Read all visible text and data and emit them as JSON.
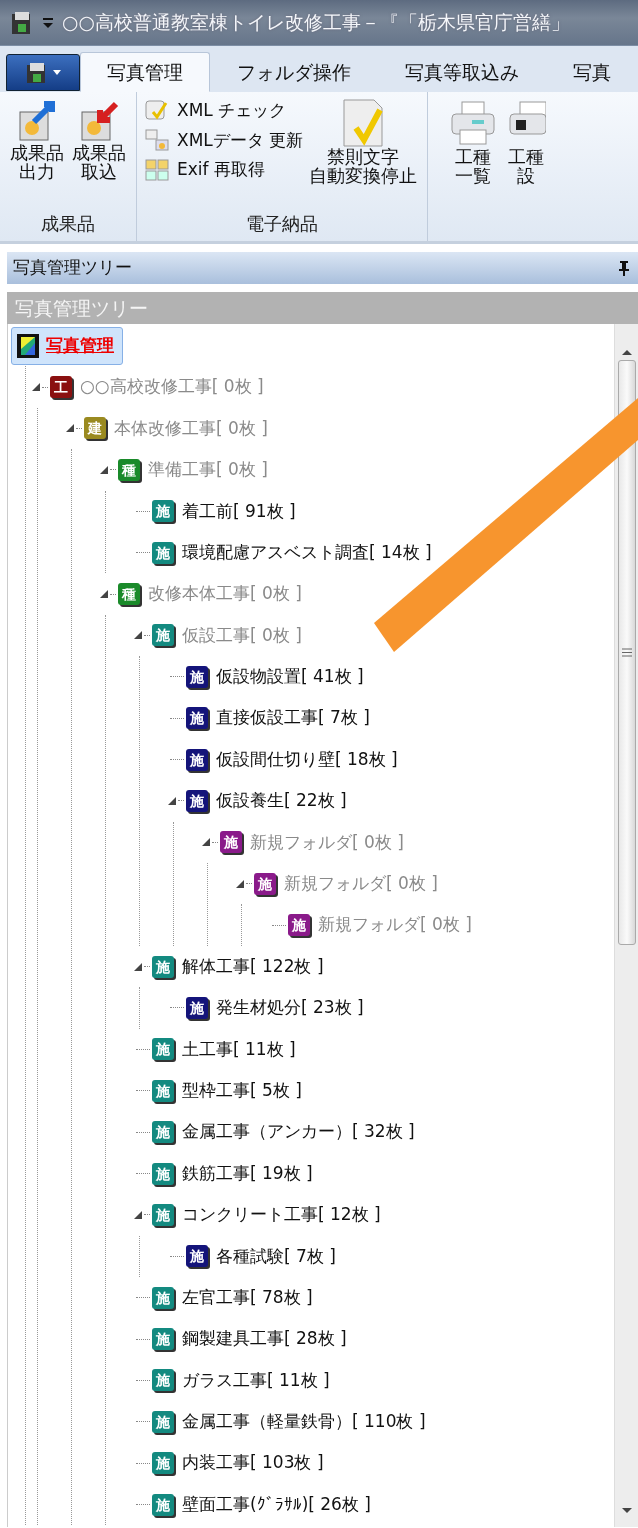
{
  "window": {
    "title": "○○高校普通教室棟トイレ改修工事－『「栃木県官庁営繕」"
  },
  "ribbon": {
    "tabs": [
      {
        "label": "写真管理",
        "selected": true
      },
      {
        "label": "フォルダ操作",
        "selected": false
      },
      {
        "label": "写真等取込み",
        "selected": false
      },
      {
        "label": "写真",
        "selected": false
      }
    ],
    "groups": [
      {
        "label": "成果品",
        "items": [
          {
            "kind": "large",
            "lines": [
              "成果品",
              "出力"
            ]
          },
          {
            "kind": "large",
            "lines": [
              "成果品",
              "取込"
            ]
          }
        ]
      },
      {
        "label": "電子納品",
        "items": [
          {
            "kind": "small",
            "lines": [
              "XML チェック"
            ]
          },
          {
            "kind": "small",
            "lines": [
              "XMLデータ 更新"
            ]
          },
          {
            "kind": "small",
            "lines": [
              "Exif 再取得"
            ]
          },
          {
            "kind": "large",
            "lines": [
              "禁則文字",
              "自動変換停止"
            ]
          }
        ]
      },
      {
        "items": [
          {
            "kind": "large",
            "lines": [
              "工種",
              "一覧"
            ]
          },
          {
            "kind": "large",
            "lines": [
              "工種",
              "設"
            ]
          }
        ]
      }
    ]
  },
  "panel": {
    "title": "写真管理ツリー",
    "subtitle": "写真管理ツリー"
  },
  "tree": {
    "label": "写真管理",
    "selected": true,
    "children": [
      {
        "mark": "工",
        "color": "#8a1010",
        "label": "○○高校改修工事[ 0枚 ]",
        "dimmed": true,
        "expanded": true,
        "children": [
          {
            "mark": "建",
            "color": "#9a8a20",
            "label": "本体改修工事[ 0枚 ]",
            "dimmed": true,
            "expanded": true,
            "children": [
              {
                "mark": "種",
                "color": "#1a8a2a",
                "label": "準備工事[ 0枚 ]",
                "dimmed": true,
                "expanded": true,
                "children": [
                  {
                    "mark": "施",
                    "color": "#138a80",
                    "label": "着工前[ 91枚 ]",
                    "dimmed": false
                  },
                  {
                    "mark": "施",
                    "color": "#138a80",
                    "label": "環境配慮アスベスト調査[ 14枚 ]",
                    "dimmed": false
                  }
                ]
              },
              {
                "mark": "種",
                "color": "#1a8a2a",
                "label": "改修本体工事[ 0枚 ]",
                "dimmed": true,
                "expanded": true,
                "children": [
                  {
                    "mark": "施",
                    "color": "#138a80",
                    "label": "仮設工事[ 0枚 ]",
                    "dimmed": true,
                    "expanded": true,
                    "children": [
                      {
                        "mark": "施",
                        "color": "#14147a",
                        "label": "仮設物設置[ 41枚 ]",
                        "dimmed": false
                      },
                      {
                        "mark": "施",
                        "color": "#14147a",
                        "label": "直接仮設工事[ 7枚 ]",
                        "dimmed": false
                      },
                      {
                        "mark": "施",
                        "color": "#14147a",
                        "label": "仮設間仕切り壁[ 18枚 ]",
                        "dimmed": false
                      },
                      {
                        "mark": "施",
                        "color": "#14147a",
                        "label": "仮設養生[ 22枚 ]",
                        "dimmed": false,
                        "expanded": true,
                        "children": [
                          {
                            "mark": "施",
                            "color": "#8a1a8a",
                            "label": "新規フォルダ[ 0枚 ]",
                            "dimmed": true,
                            "expanded": true,
                            "children": [
                              {
                                "mark": "施",
                                "color": "#8a1a8a",
                                "label": "新規フォルダ[ 0枚 ]",
                                "dimmed": true,
                                "expanded": true,
                                "children": [
                                  {
                                    "mark": "施",
                                    "color": "#8a1a8a",
                                    "label": "新規フォルダ[ 0枚 ]",
                                    "dimmed": true
                                  }
                                ]
                              }
                            ]
                          }
                        ]
                      }
                    ]
                  },
                  {
                    "mark": "施",
                    "color": "#138a80",
                    "label": "解体工事[ 122枚 ]",
                    "dimmed": false,
                    "expanded": true,
                    "children": [
                      {
                        "mark": "施",
                        "color": "#14147a",
                        "label": "発生材処分[ 23枚 ]",
                        "dimmed": false
                      }
                    ]
                  },
                  {
                    "mark": "施",
                    "color": "#138a80",
                    "label": "土工事[ 11枚 ]",
                    "dimmed": false
                  },
                  {
                    "mark": "施",
                    "color": "#138a80",
                    "label": "型枠工事[ 5枚 ]",
                    "dimmed": false
                  },
                  {
                    "mark": "施",
                    "color": "#138a80",
                    "label": "金属工事（アンカー）[ 32枚 ]",
                    "dimmed": false
                  },
                  {
                    "mark": "施",
                    "color": "#138a80",
                    "label": "鉄筋工事[ 19枚 ]",
                    "dimmed": false
                  },
                  {
                    "mark": "施",
                    "color": "#138a80",
                    "label": "コンクリート工事[ 12枚 ]",
                    "dimmed": false,
                    "expanded": true,
                    "children": [
                      {
                        "mark": "施",
                        "color": "#14147a",
                        "label": "各種試験[ 7枚 ]",
                        "dimmed": false
                      }
                    ]
                  },
                  {
                    "mark": "施",
                    "color": "#138a80",
                    "label": "左官工事[ 78枚 ]",
                    "dimmed": false
                  },
                  {
                    "mark": "施",
                    "color": "#138a80",
                    "label": "鋼製建具工事[ 28枚 ]",
                    "dimmed": false
                  },
                  {
                    "mark": "施",
                    "color": "#138a80",
                    "label": "ガラス工事[ 11枚 ]",
                    "dimmed": false
                  },
                  {
                    "mark": "施",
                    "color": "#138a80",
                    "label": "金属工事（軽量鉄骨）[ 110枚 ]",
                    "dimmed": false
                  },
                  {
                    "mark": "施",
                    "color": "#138a80",
                    "label": "内装工事[ 103枚 ]",
                    "dimmed": false
                  },
                  {
                    "mark": "施",
                    "color": "#138a80",
                    "label": "壁面工事(ｸﾞﾗｻﾙ)[ 26枚 ]",
                    "dimmed": false
                  }
                ]
              }
            ]
          }
        ]
      }
    ]
  }
}
